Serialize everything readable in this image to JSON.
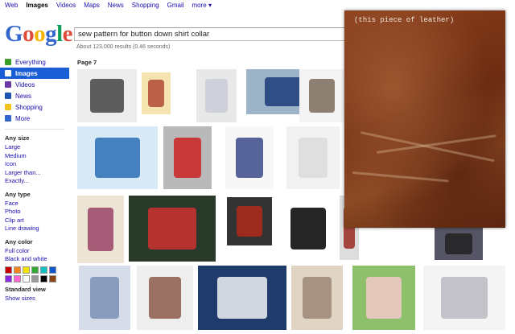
{
  "topnav": {
    "items": [
      "Web",
      "Images",
      "Videos",
      "Maps",
      "News",
      "Shopping",
      "Gmail",
      "more ▾"
    ],
    "active": "Images"
  },
  "logo": {
    "letters": [
      {
        "char": "G",
        "color": "#3366cc"
      },
      {
        "char": "o",
        "color": "#dd4b39"
      },
      {
        "char": "o",
        "color": "#f4b400"
      },
      {
        "char": "g",
        "color": "#3366cc"
      },
      {
        "char": "l",
        "color": "#0f9d58"
      },
      {
        "char": "e",
        "color": "#dd4b39"
      }
    ]
  },
  "search": {
    "query": "sew pattern for button down shirt collar"
  },
  "result_stats": "About 123,000 results (0.46 seconds)",
  "page_label": "Page 7",
  "sidebar": {
    "items": [
      {
        "label": "Everything",
        "icon": "everything-icon",
        "icon_color": "#3c9f2a",
        "active": false
      },
      {
        "label": "Images",
        "icon": "images-icon",
        "icon_color": "#ffffff",
        "active": true
      },
      {
        "label": "Videos",
        "icon": "videos-icon",
        "icon_color": "#6c3aa6",
        "active": false
      },
      {
        "label": "News",
        "icon": "news-icon",
        "icon_color": "#1d55b5",
        "active": false
      },
      {
        "label": "Shopping",
        "icon": "shopping-icon",
        "icon_color": "#f0c419",
        "active": false
      },
      {
        "label": "More",
        "icon": "more-icon",
        "icon_color": "#3366cc",
        "active": false
      }
    ],
    "size_title": "Any size",
    "size_options": [
      "Large",
      "Medium",
      "Icon",
      "Larger than...",
      "Exactly..."
    ],
    "type_title": "Any type",
    "type_options": [
      "Face",
      "Photo",
      "Clip art",
      "Line drawing"
    ],
    "color_title": "Any color",
    "color_options": [
      "Full color",
      "Black and white"
    ],
    "swatches": [
      "#cc0000",
      "#f58220",
      "#f4e300",
      "#33aa33",
      "#11c0c0",
      "#1155cc",
      "#8a2be2",
      "#ff66cc",
      "#ffffff",
      "#999999",
      "#000000",
      "#8b4513"
    ],
    "view_title": "Standard view",
    "view_link": "Show sizes"
  },
  "thumbnails": [
    {
      "label": "pattern-pieces",
      "bg": "#ececec",
      "accent": "#444"
    },
    {
      "label": "pattern-envelopes",
      "bg": "#f3e4b0",
      "accent": "#b04a38"
    },
    {
      "label": "white-shirt",
      "bg": "#e8e8e8",
      "accent": "#c9cdd6"
    },
    {
      "label": "sewing-fabric",
      "bg": "#9db4c8",
      "accent": "#1d3c7a"
    },
    {
      "label": "sewing-basket",
      "bg": "#f4f4f4",
      "accent": "#7a6a5a"
    },
    {
      "label": "diagram-neck",
      "bg": "#d9eaf7",
      "accent": "#2a6fb5"
    },
    {
      "label": "red-back-shirt",
      "bg": "#b9b9b9",
      "accent": "#c22"
    },
    {
      "label": "two-models",
      "bg": "#f7f7f7",
      "accent": "#3b4a8a"
    },
    {
      "label": "western-shirt",
      "bg": "#f2f2f2",
      "accent": "#dcdcdc"
    },
    {
      "label": "mccalls-pattern",
      "bg": "#ede4d6",
      "accent": "#946"
    },
    {
      "label": "hand-fabric",
      "bg": "#2a3a2a",
      "accent": "#c33"
    },
    {
      "label": "red-shirt-man",
      "bg": "#333",
      "accent": "#b02a1a"
    },
    {
      "label": "mpb-sew-along",
      "bg": "#ffffff",
      "accent": "#000"
    },
    {
      "label": "plaid-shirt",
      "bg": "#ddd",
      "accent": "#9a2a22"
    },
    {
      "label": "blue-oxford",
      "bg": "#d7dde8",
      "accent": "#7c90b6"
    },
    {
      "label": "patterned-shirt",
      "bg": "#eee",
      "accent": "#8b5a4a"
    },
    {
      "label": "tv-shirts",
      "bg": "#1f3b6b",
      "accent": "#f2f2f2"
    },
    {
      "label": "tan-shirt",
      "bg": "#e0d4c4",
      "accent": "#9a8676"
    },
    {
      "label": "two-girls",
      "bg": "#8ebf6a",
      "accent": "#f2c8c8"
    },
    {
      "label": "collar-closeup",
      "bg": "#f4f4f4",
      "accent": "#b8b8c0"
    },
    {
      "label": "dark-placket",
      "bg": "#556",
      "accent": "#222"
    }
  ],
  "overlay": {
    "caption": "(this piece of leather)"
  }
}
